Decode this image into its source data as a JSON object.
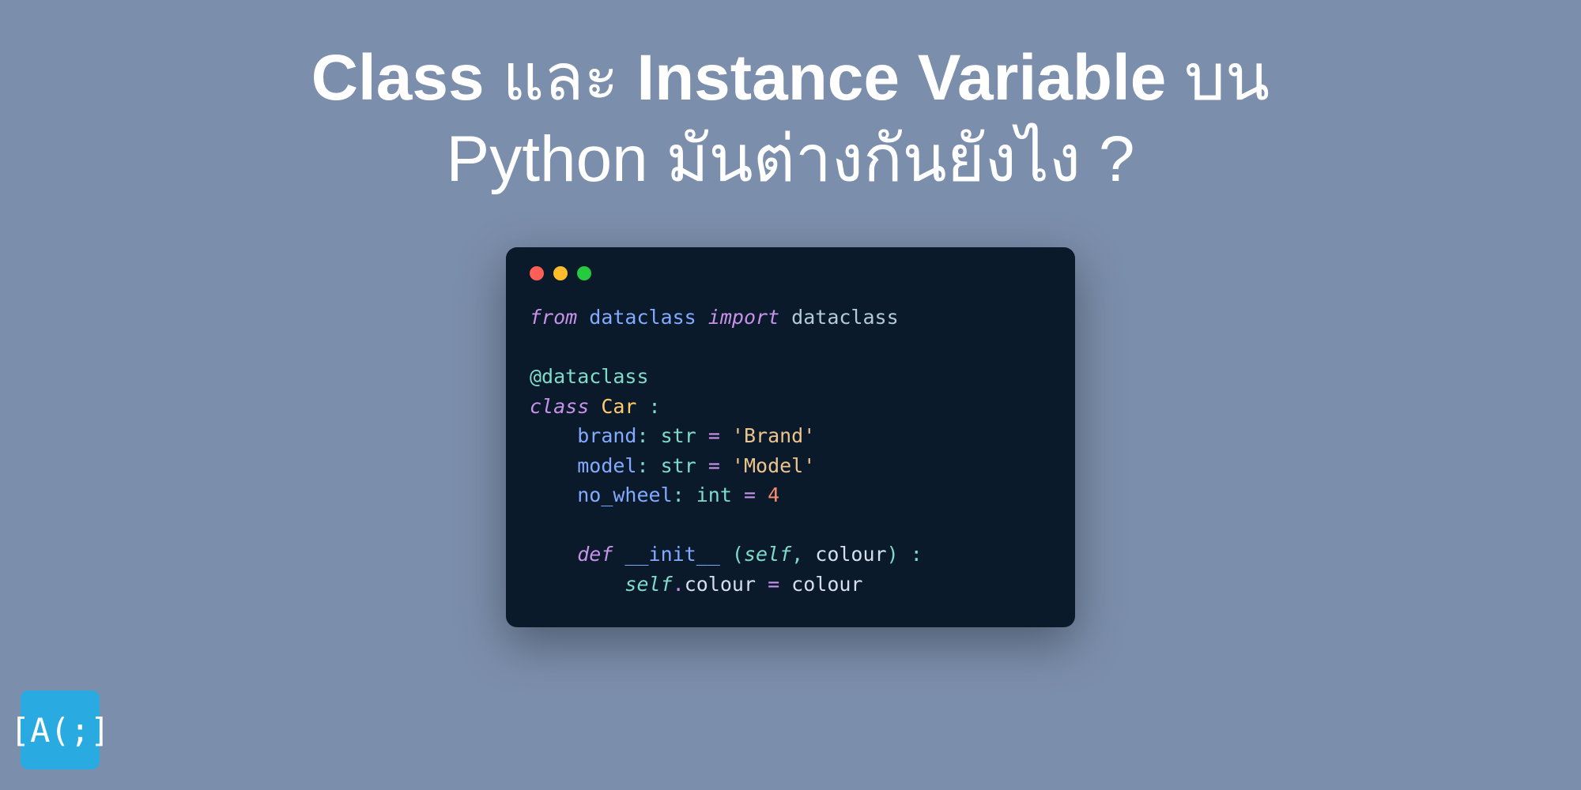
{
  "title": {
    "bold1": "Class",
    "mid1": " และ ",
    "bold2": "Instance Variable",
    "end1": " บน",
    "line2": "Python มันต่างกันยังไง ?"
  },
  "code": {
    "l1_from": "from",
    "l1_module": " dataclass ",
    "l1_import": "import",
    "l1_name": " dataclass",
    "l3_decorator": "@dataclass",
    "l4_class": "class",
    "l4_name": " Car ",
    "l4_colon": ":",
    "l5_indent": "    ",
    "l5_attr": "brand",
    "l5_colon": ":",
    "l5_type": " str ",
    "l5_eq": "=",
    "l5_val": " 'Brand'",
    "l6_attr": "model",
    "l6_colon": ":",
    "l6_type": " str ",
    "l6_eq": "=",
    "l6_val": " 'Model'",
    "l7_attr": "no_wheel",
    "l7_colon": ":",
    "l7_type": " int ",
    "l7_eq": "=",
    "l7_val": " 4",
    "l9_def": "def",
    "l9_func": " __init__ ",
    "l9_open": "(",
    "l9_self": "self",
    "l9_comma": ", ",
    "l9_param": "colour",
    "l9_close": ") ",
    "l9_colon": ":",
    "l10_indent": "        ",
    "l10_self": "self",
    "l10_dot": ".",
    "l10_prop": "colour",
    "l10_eq": " = ",
    "l10_val": "colour"
  },
  "logo": {
    "text": "[A(;]"
  }
}
